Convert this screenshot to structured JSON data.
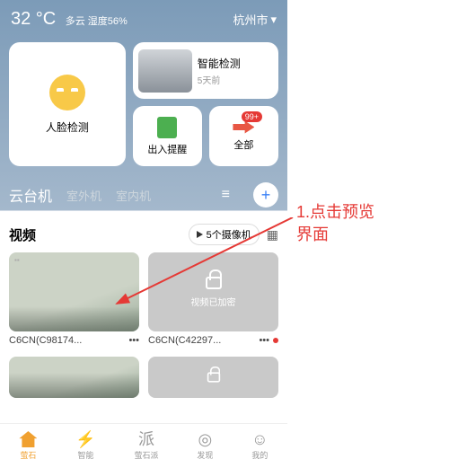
{
  "top": {
    "temp": "32 °C",
    "weather": "多云 湿度56%",
    "city": "杭州市"
  },
  "cards": {
    "face": "人脸检测",
    "detect": {
      "title": "智能检测",
      "sub": "5天前"
    },
    "door": "出入提醒",
    "all": "全部",
    "badge": "99+"
  },
  "tabs": {
    "ptz": "云台机",
    "outdoor": "室外机",
    "indoor": "室内机"
  },
  "section": {
    "title": "视频",
    "pill": "5个摄像机"
  },
  "videos": {
    "v1": "C6CN(C98174...",
    "v2": "C6CN(C42297...",
    "locked": "视频已加密"
  },
  "nav": {
    "n1": "萤石",
    "n2": "智能",
    "n3": "萤石派",
    "n4": "发现",
    "n5": "我的"
  },
  "nav_glyph": {
    "n2": "⚡",
    "n3": "派",
    "n4": "◎",
    "n5": "☺"
  },
  "annot": {
    "line1": "1.点击预览",
    "line2": "界面"
  },
  "dots": "•••"
}
